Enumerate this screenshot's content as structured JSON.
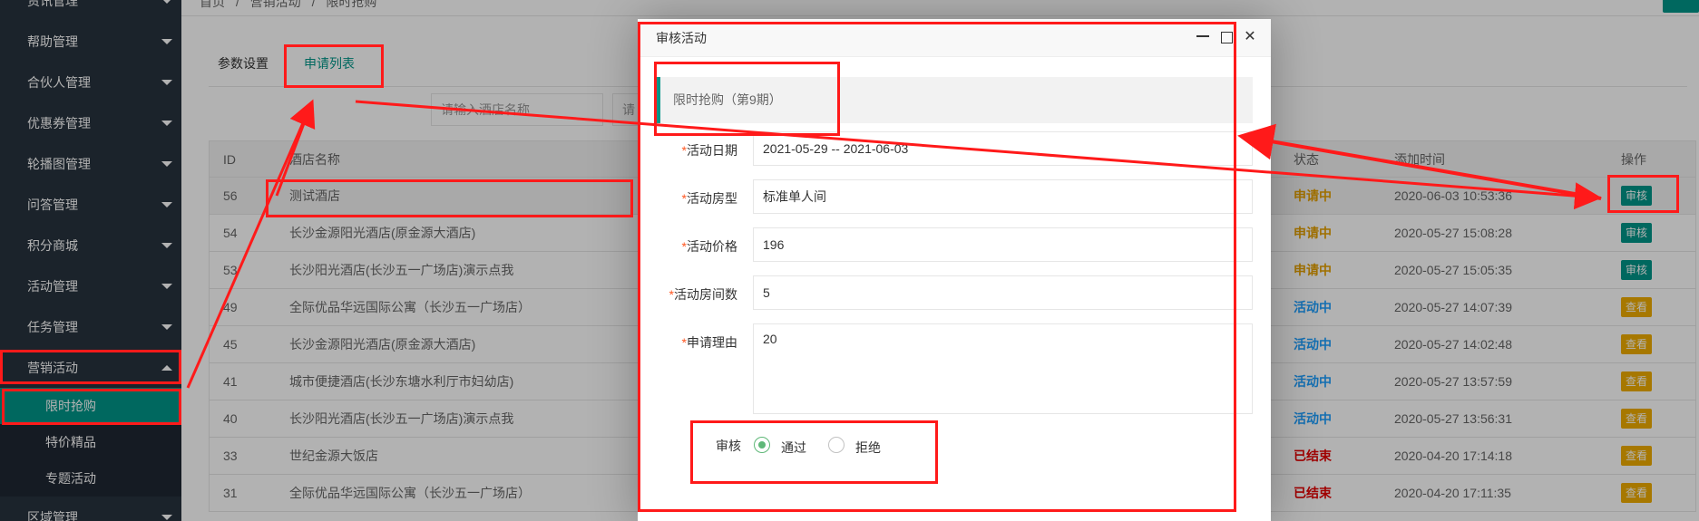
{
  "sidebar": {
    "items": [
      {
        "label": "资讯管理"
      },
      {
        "label": "帮助管理"
      },
      {
        "label": "合伙人管理"
      },
      {
        "label": "优惠券管理"
      },
      {
        "label": "轮播图管理"
      },
      {
        "label": "问答管理"
      },
      {
        "label": "积分商城"
      },
      {
        "label": "活动管理"
      },
      {
        "label": "任务管理"
      },
      {
        "label": "营销活动"
      }
    ],
    "subitems": [
      {
        "label": "限时抢购"
      },
      {
        "label": "特价精品"
      },
      {
        "label": "专题活动"
      }
    ],
    "last_item": "区域管理"
  },
  "breadcrumb": [
    "首页",
    "/",
    "营销活动",
    "/",
    "限时抢购"
  ],
  "tabs": [
    {
      "label": "参数设置"
    },
    {
      "label": "申请列表"
    }
  ],
  "search": {
    "hotel_placeholder": "请输入酒店名称",
    "second_placeholder": "请"
  },
  "table": {
    "headers": {
      "id": "ID",
      "hotel": "酒店名称",
      "status": "状态",
      "time": "添加时间",
      "op": "操作"
    },
    "rows": [
      {
        "id": "56",
        "hotel": "测试酒店",
        "status": "申请中",
        "time": "2020-06-03 10:53:36",
        "op": "审核"
      },
      {
        "id": "54",
        "hotel": "长沙金源阳光酒店(原金源大酒店)",
        "status": "申请中",
        "time": "2020-05-27 15:08:28",
        "op": "审核"
      },
      {
        "id": "53",
        "hotel": "长沙阳光酒店(长沙五一广场店)演示点我",
        "status": "申请中",
        "time": "2020-05-27 15:05:35",
        "op": "审核"
      },
      {
        "id": "49",
        "hotel": "全际优品华远国际公寓（长沙五一广场店）",
        "status": "活动中",
        "time": "2020-05-27 14:07:39",
        "op": "查看"
      },
      {
        "id": "45",
        "hotel": "长沙金源阳光酒店(原金源大酒店)",
        "status": "活动中",
        "time": "2020-05-27 14:02:48",
        "op": "查看"
      },
      {
        "id": "41",
        "hotel": "城市便捷酒店(长沙东塘水利厅市妇幼店)",
        "status": "活动中",
        "time": "2020-05-27 13:57:59",
        "op": "查看"
      },
      {
        "id": "40",
        "hotel": "长沙阳光酒店(长沙五一广场店)演示点我",
        "status": "活动中",
        "time": "2020-05-27 13:56:31",
        "op": "查看"
      },
      {
        "id": "33",
        "hotel": "世纪金源大饭店",
        "status": "已结束",
        "time": "2020-04-20 17:14:18",
        "op": "查看"
      },
      {
        "id": "31",
        "hotel": "全际优品华远国际公寓（长沙五一广场店）",
        "status": "已结束",
        "time": "2020-04-20 17:11:35",
        "op": "查看"
      }
    ]
  },
  "modal": {
    "title": "审核活动",
    "section": "限时抢购（第9期）",
    "fields": {
      "date_label": "活动日期",
      "date_value": "2021-05-29 -- 2021-06-03",
      "room_label": "活动房型",
      "room_value": "标准单人间",
      "price_label": "活动价格",
      "price_value": "196",
      "count_label": "活动房间数",
      "count_value": "5",
      "reason_label": "申请理由",
      "reason_value": "20"
    },
    "review": {
      "label": "审核",
      "approve": "通过",
      "reject": "拒绝",
      "selected": "通过"
    },
    "required_mark": "*"
  },
  "colors": {
    "accent": "#009688",
    "sidebar_bg": "#28333e",
    "status_applying": "#e6a100",
    "status_active": "#1e9fff",
    "status_ended": "#e60000",
    "annotation": "#ff1a1a"
  }
}
